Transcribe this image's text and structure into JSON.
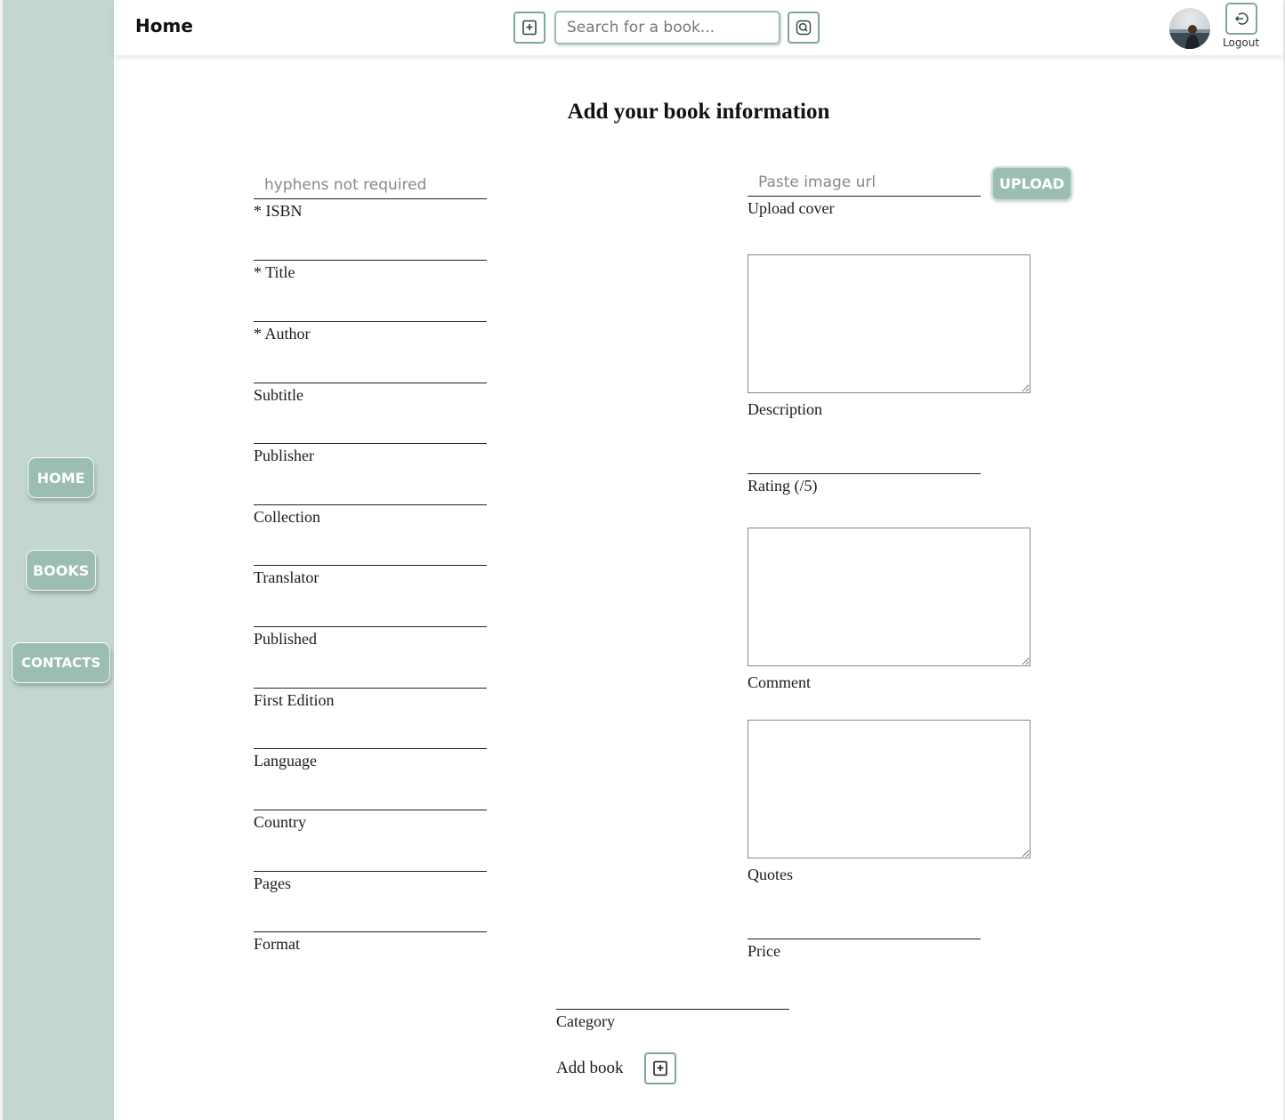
{
  "header": {
    "title": "Home",
    "search_placeholder": "Search for a book...",
    "logout_label": "Logout"
  },
  "sidebar": {
    "items": [
      {
        "label": "HOME"
      },
      {
        "label": "BOOKS"
      },
      {
        "label": "CONTACTS"
      }
    ]
  },
  "form": {
    "heading": "Add your book information",
    "isbn_placeholder": "hyphens not required",
    "left_fields": [
      "* ISBN",
      "* Title",
      "* Author",
      "Subtitle",
      "Publisher",
      "Collection",
      "Translator",
      "Published",
      "First Edition",
      "Language",
      "Country",
      "Pages",
      "Format"
    ],
    "cover_placeholder": "Paste image url",
    "upload_label": "UPLOAD",
    "upload_cover_label": "Upload cover",
    "description_label": "Description",
    "rating_label": "Rating (/5)",
    "comment_label": "Comment",
    "quotes_label": "Quotes",
    "price_label": "Price",
    "category_label": "Category",
    "add_book_label": "Add book"
  },
  "icons": {
    "add": "plus-square-icon",
    "search": "search-icon",
    "logout": "logout-icon",
    "avatar": "user-avatar"
  },
  "colors": {
    "sidebar": "#c3d6d0",
    "accent": "#9bbdb2",
    "border_accent": "#7da89b"
  }
}
